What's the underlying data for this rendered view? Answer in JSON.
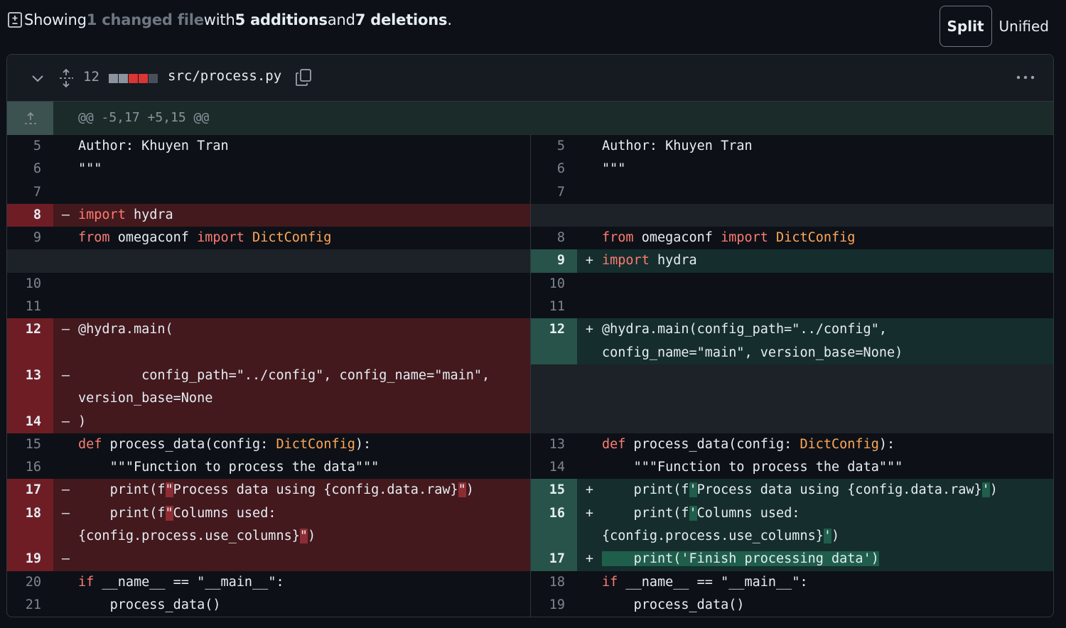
{
  "summary": {
    "prefix": "Showing ",
    "changed": "1 changed file",
    "with": " with ",
    "additions": "5 additions",
    "and": " and ",
    "deletions": "7 deletions",
    "end": "."
  },
  "view_toggle": {
    "split": "Split",
    "unified": "Unified"
  },
  "file": {
    "change_count": "12",
    "path": "src/process.py"
  },
  "hunk_header": "@@ -5,17 +5,15 @@",
  "lines": {
    "l5": "Author: Khuyen Tran",
    "l6": "\"\"\"",
    "del_import": "import",
    "del_hydra": " hydra",
    "from1": "from",
    "omegaconf": " omegaconf ",
    "import1": "import",
    "dictconfig": " DictConfig",
    "add_import": "import",
    "add_hydra": " hydra",
    "left_deco": "@hydra.main(",
    "left_args1": "        config_path=\"../config\", config_name=\"main\",",
    "left_args2": "version_base=None",
    "left_close": ")",
    "right_deco1": "@hydra.main(config_path=\"../config\",",
    "right_deco2": "config_name=\"main\", version_base=None)",
    "def": "def",
    "def_sig_a": " process_data(config: ",
    "def_type": "DictConfig",
    "def_sig_b": "):",
    "docstring": "    \"\"\"Function to process the data\"\"\"",
    "print1_a": "    print(f",
    "print1_del_q": "\"",
    "print1_add_q": "'",
    "print1_b": "Process data using {config.data.raw}",
    "print1_c": ")",
    "print2_a": "    print(f",
    "print2_b": "Columns used:",
    "print2_c": "{config.process.use_columns}",
    "print2_d": ")",
    "print3": "    print('Finish processing data')",
    "if_kw": "if",
    "if_rest": " __name__ == \"__main__\":",
    "call": "    process_data()"
  },
  "markers": {
    "del": "–",
    "add": "+"
  },
  "line_numbers": {
    "left": [
      "5",
      "6",
      "7",
      "8",
      "9",
      "10",
      "11",
      "12",
      "13",
      "14",
      "15",
      "16",
      "17",
      "18",
      "19",
      "20",
      "21"
    ],
    "right": [
      "5",
      "6",
      "7",
      "8",
      "9",
      "10",
      "11",
      "12",
      "13",
      "14",
      "15",
      "16",
      "17",
      "18",
      "19"
    ]
  },
  "colors": {
    "deleted": "#6f1d25",
    "added": "#27534a",
    "keyword": "#ff7b72",
    "type": "#ffa657"
  },
  "icons": [
    "file-diff-icon",
    "chevron-down-icon",
    "expand-icon",
    "copy-icon",
    "kebab-icon",
    "expand-up-icon"
  ]
}
